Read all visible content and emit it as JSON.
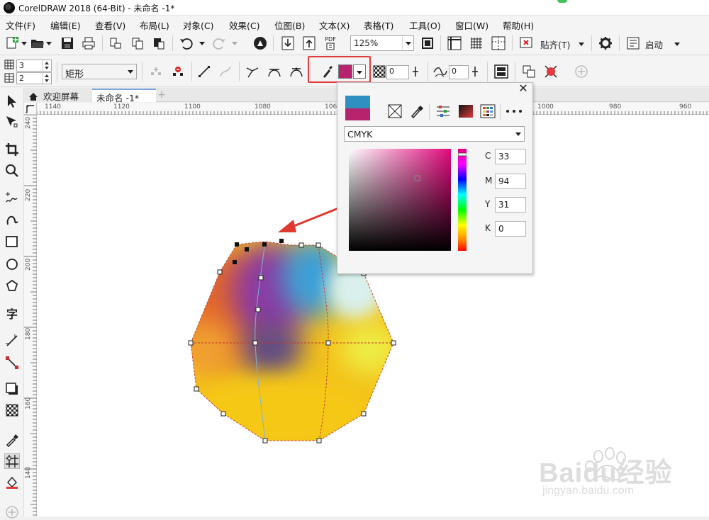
{
  "window": {
    "title": "CorelDRAW 2018 (64-Bit) - 未命名 -1*"
  },
  "menu": {
    "items": [
      "文件(F)",
      "编辑(E)",
      "查看(V)",
      "布局(L)",
      "对象(C)",
      "效果(C)",
      "位图(B)",
      "文本(X)",
      "表格(T)",
      "工具(O)",
      "窗口(W)",
      "帮助(H)"
    ]
  },
  "toolbar": {
    "zoom": "125%",
    "snap_label": "贴齐(T)",
    "launch_label": "启动",
    "pdf_label": "PDF"
  },
  "propbar": {
    "cols_value": "3",
    "rows_value": "2",
    "shape_type": "矩形",
    "transparency_value": "0",
    "smooth_value": "0"
  },
  "tabs": {
    "welcome": "欢迎屏幕",
    "document": "未命名 -1*"
  },
  "ruler": {
    "h_labels": [
      "1140",
      "1120",
      "1100",
      "1080",
      "106",
      "1000",
      "980",
      "960"
    ],
    "v_labels": [
      "240",
      "220",
      "200",
      "180",
      "160",
      "140"
    ]
  },
  "color_popup": {
    "color_model": "CMYK",
    "c_label": "C",
    "c_value": "33",
    "m_label": "M",
    "m_value": "94",
    "y_label": "Y",
    "y_value": "31",
    "k_label": "K",
    "k_value": "0",
    "old_color": "#2f8fc1",
    "new_color": "#b7246e"
  },
  "colors": {
    "selected_fill": "#b7246e",
    "highlight_red": "#e23a3a",
    "arrow_red": "#e0392f"
  },
  "watermark": {
    "brand": "Baidu经验",
    "url": "jingyan.baidu.com"
  }
}
